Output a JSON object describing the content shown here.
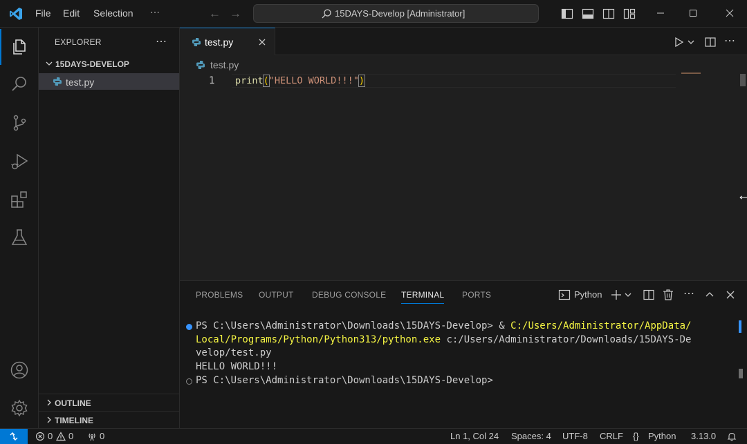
{
  "titlebar": {
    "menu": [
      "File",
      "Edit",
      "Selection",
      "⋯"
    ],
    "search_text": "15DAYS-Develop [Administrator]"
  },
  "sidebar": {
    "title": "EXPLORER",
    "more": "⋯",
    "folder": "15DAYS-DEVELOP",
    "file": "test.py",
    "outline": "OUTLINE",
    "timeline": "TIMELINE"
  },
  "editor": {
    "tab_label": "test.py",
    "breadcrumb": "test.py",
    "line_number": "1",
    "code": {
      "fn": "print",
      "open": "(",
      "str": "\"HELLO WORLD!!!\"",
      "close": ")"
    }
  },
  "panel": {
    "tabs": [
      "PROBLEMS",
      "OUTPUT",
      "DEBUG CONSOLE",
      "TERMINAL",
      "PORTS"
    ],
    "active_tab": "TERMINAL",
    "terminal_name": "Python",
    "terminal": {
      "l1_prompt": "PS C:\\Users\\Administrator\\Downloads\\15DAYS-Develop> & ",
      "l1_path": "C:/Users/Administrator/AppData/",
      "l2_path": "Local/Programs/Python/Python313/python.exe",
      "l2_rest": " c:/Users/Administrator/Downloads/15DAYS-De",
      "l3": "velop/test.py",
      "l4": "HELLO WORLD!!!",
      "l5": "PS C:\\Users\\Administrator\\Downloads\\15DAYS-Develop>"
    }
  },
  "statusbar": {
    "errors": "0",
    "warnings": "0",
    "ports": "0",
    "position": "Ln 1, Col 24",
    "spaces": "Spaces: 4",
    "encoding": "UTF-8",
    "eol": "CRLF",
    "language": "Python",
    "version": "3.13.0"
  },
  "colors": {
    "accent": "#0078d4",
    "background": "#1f1f1f",
    "function": "#dcdcaa",
    "string": "#ce9178",
    "terminal_path": "#f5f543"
  }
}
